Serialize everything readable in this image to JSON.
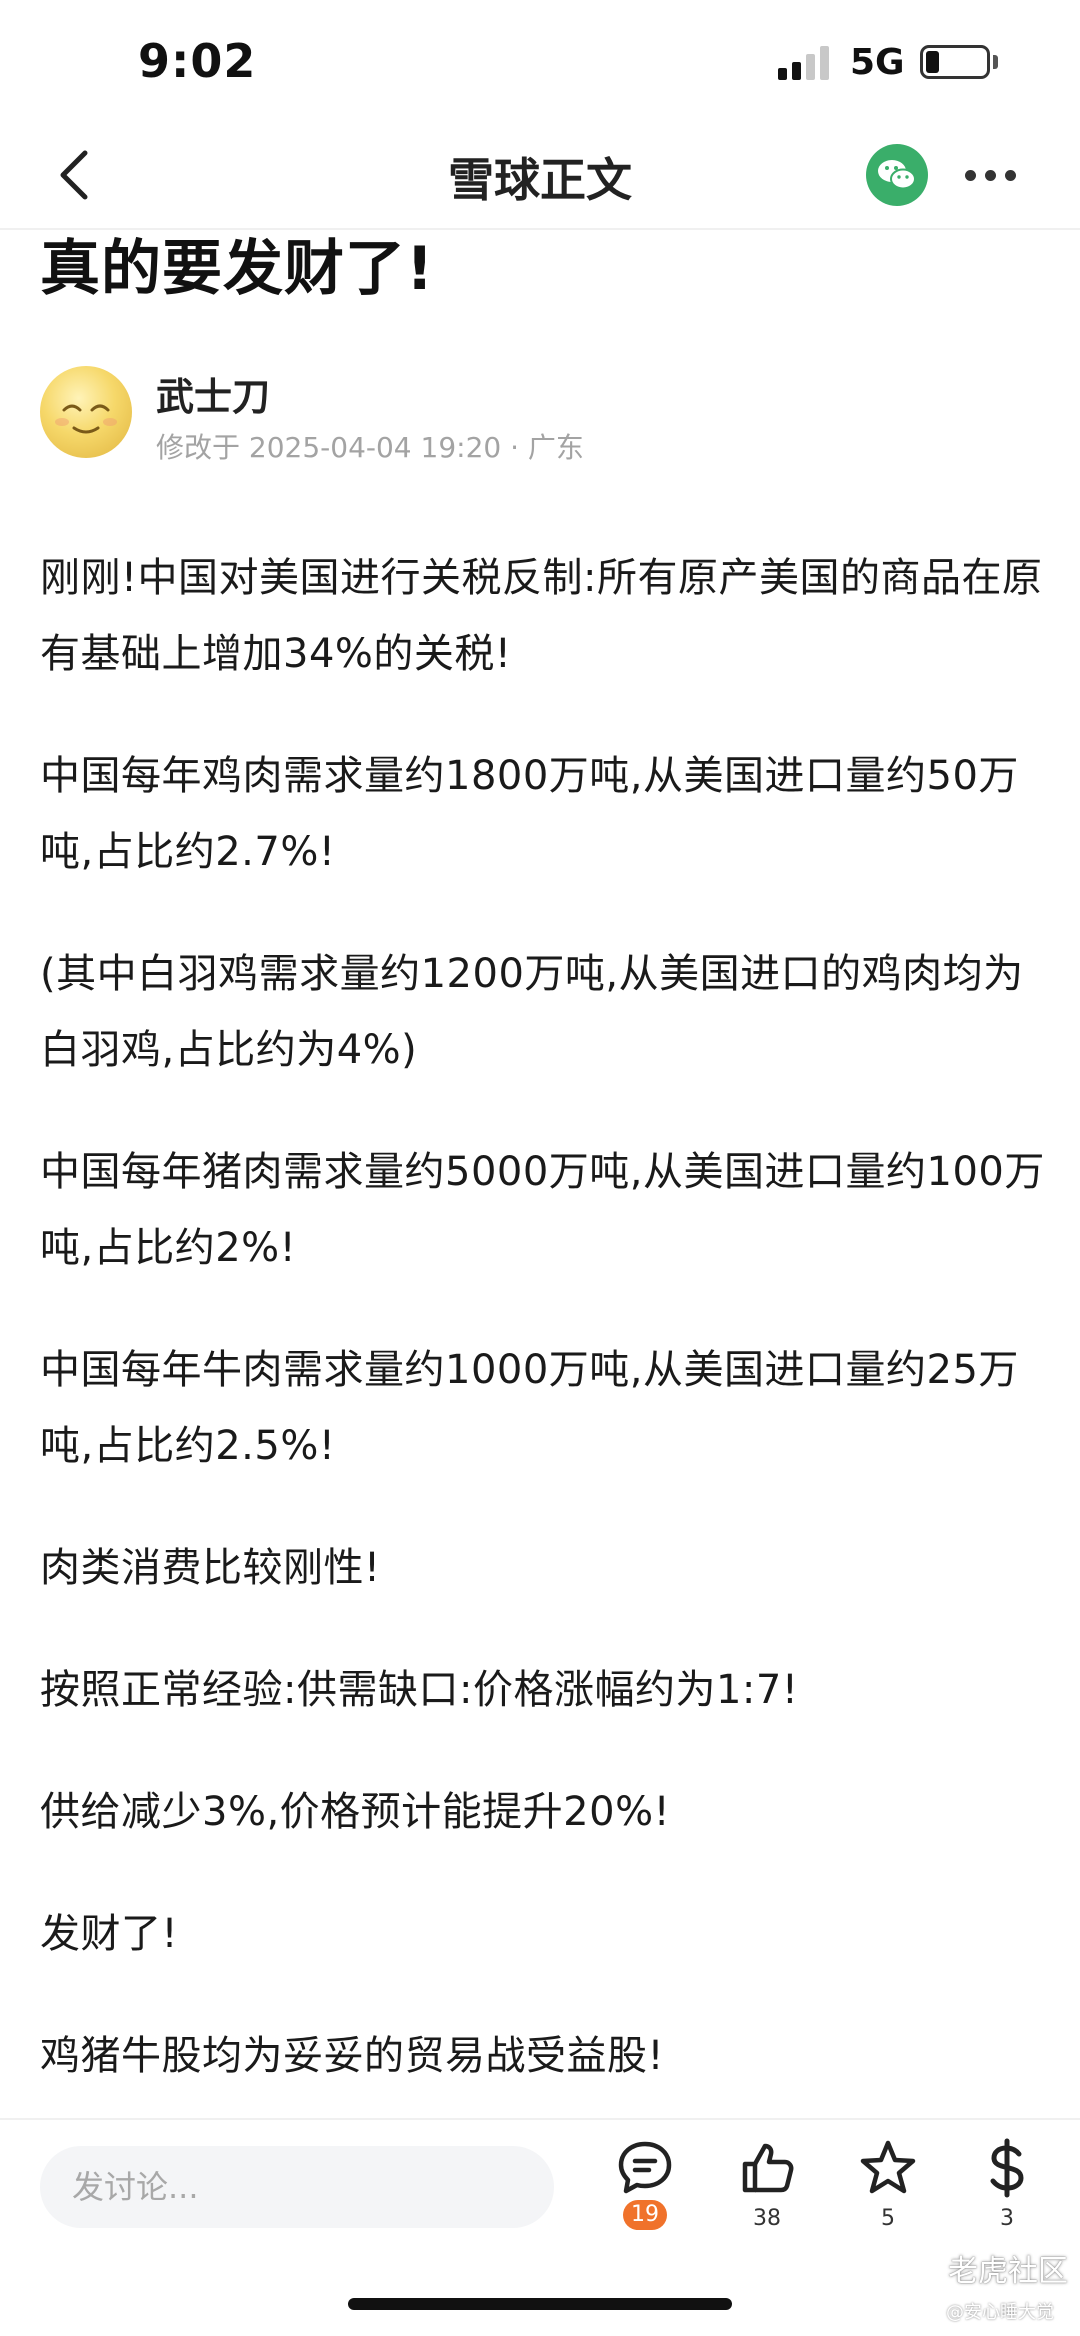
{
  "status_bar": {
    "time": "9:02",
    "network": "5G"
  },
  "nav": {
    "title": "雪球正文"
  },
  "post": {
    "title": "真的要发财了!",
    "author": "武士刀",
    "meta": "修改于 2025-04-04 19:20 · 广东",
    "paragraphs": [
      "刚刚!中国对美国进行关税反制:所有原产美国的商品在原有基础上增加34%的关税!",
      "中国每年鸡肉需求量约1800万吨,从美国进口量约50万吨,占比约2.7%!",
      "(其中白羽鸡需求量约1200万吨,从美国进口的鸡肉均为白羽鸡,占比约为4%)",
      "中国每年猪肉需求量约5000万吨,从美国进口量约100万吨,占比约2%!",
      "中国每年牛肉需求量约1000万吨,从美国进口量约25万吨,占比约2.5%!",
      "肉类消费比较刚性!",
      "按照正常经验:供需缺口:价格涨幅约为1:7!",
      "供给减少3%,价格预计能提升20%!",
      "发财了!",
      "鸡猪牛股均为妥妥的贸易战受益股!"
    ]
  },
  "bottom_bar": {
    "comment_placeholder": "发讨论...",
    "comments_count": "19",
    "likes_count": "38",
    "favorites_count": "5",
    "rewards_count": "3"
  },
  "watermark": {
    "logo_text": "老虎社区",
    "user": "@安心睡大觉"
  },
  "colors": {
    "badge": "#f0722b",
    "wechat": "#3aae6a"
  }
}
